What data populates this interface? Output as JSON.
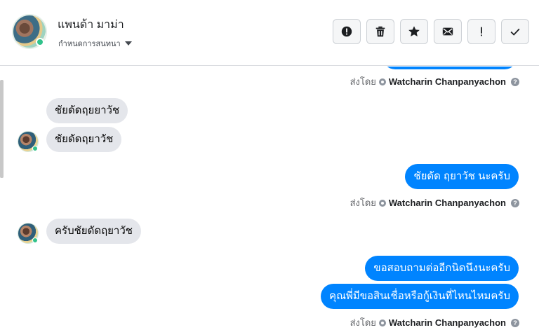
{
  "header": {
    "contact_name": "แพนด้า มาม่า",
    "conversation_settings": "กำหนดการสนทนา",
    "actions": [
      {
        "name": "report",
        "icon": "alert-circle-icon"
      },
      {
        "name": "delete",
        "icon": "trash-icon"
      },
      {
        "name": "star",
        "icon": "star-icon"
      },
      {
        "name": "mark-unread",
        "icon": "envelope-icon"
      },
      {
        "name": "important",
        "icon": "exclamation-icon"
      },
      {
        "name": "done",
        "icon": "checkmark-icon"
      }
    ]
  },
  "messages": {
    "sent_by_label": "ส่งโดย",
    "sender_name": "Watcharin Chanpanyachon",
    "incoming_1": "ชัยดัดฤยยาวัช",
    "incoming_2": "ชัยดัดฤยาวัช",
    "outgoing_1": "ชัยดัด ฤยาวัช นะครับ",
    "incoming_3": "ครับชัยดัดฤยาวัช",
    "outgoing_2": "ขอสอบถามต่ออีกนิดนึงนะครับ",
    "outgoing_3": "คุณพี่มีขอสินเชื่อหรือกู้เงินที่ไหนไหมครับ"
  },
  "colors": {
    "outgoing_bubble": "#0084ff",
    "incoming_bubble": "#e4e6eb"
  }
}
